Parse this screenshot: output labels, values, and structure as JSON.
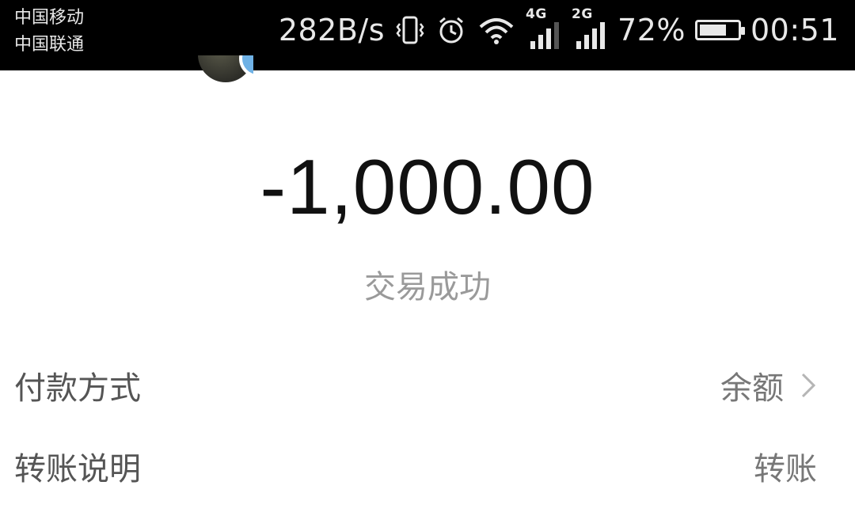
{
  "status_bar": {
    "carrier_1": "中国移动",
    "carrier_2": "中国联通",
    "speed": "282B/s",
    "sim1_network": "4G",
    "sim2_network": "2G",
    "battery_percent": "72%",
    "battery_level": 0.72,
    "time": "00:51",
    "icons": [
      "vibrate-icon",
      "alarm-icon",
      "wifi-icon",
      "signal-icon",
      "battery-icon"
    ]
  },
  "transaction": {
    "amount": "-1,000.00",
    "status": "交易成功"
  },
  "details": [
    {
      "label": "付款方式",
      "value": "余额",
      "has_chevron": true
    },
    {
      "label": "转账说明",
      "value": "转账",
      "has_chevron": false
    }
  ],
  "colors": {
    "status_bar_bg": "#000000",
    "amount_text": "#111111",
    "muted_text": "#9a9a9a",
    "verified_badge": "#6fb2e6"
  }
}
